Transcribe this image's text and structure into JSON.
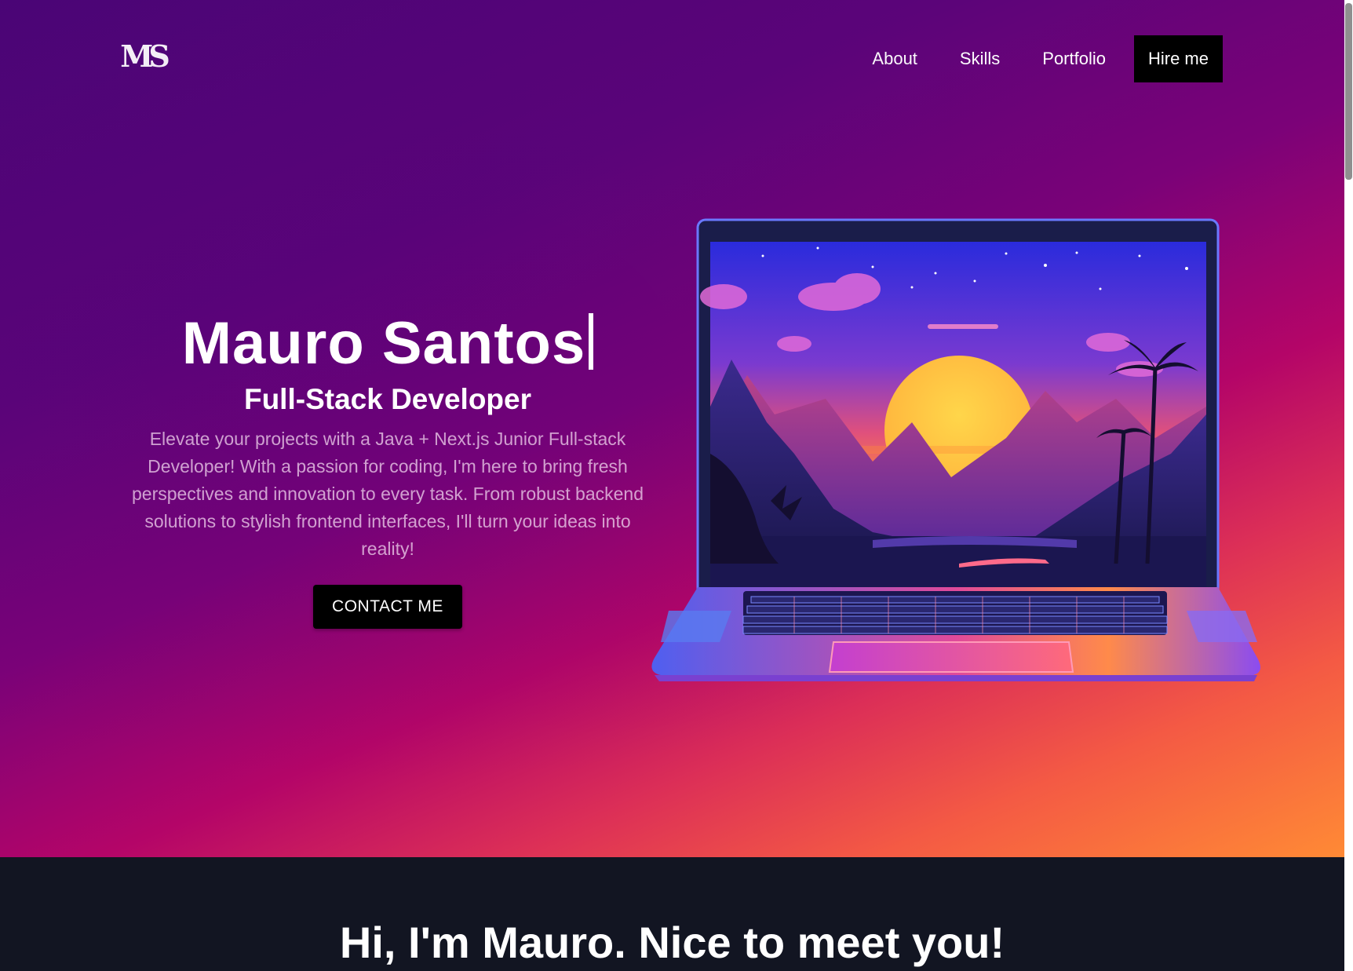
{
  "header": {
    "logo_text": "MS",
    "nav": [
      {
        "label": "About"
      },
      {
        "label": "Skills"
      },
      {
        "label": "Portfolio"
      }
    ],
    "hire_label": "Hire me"
  },
  "hero": {
    "name": "Mauro Santos",
    "role": "Full-Stack Developer",
    "description": "Elevate your projects with a Java + Next.js Junior Full-stack Developer! With a passion for coding, I'm here to bring fresh perspectives and innovation to every task. From robust backend solutions to stylish frontend interfaces, I'll turn your ideas into reality!",
    "cta_label": "CONTACT ME",
    "image_icon": "laptop-sunset-illustration"
  },
  "about": {
    "heading": "Hi, I'm Mauro. Nice to meet you!"
  },
  "colors": {
    "gradient_start": "#4a0576",
    "gradient_mid": "#b40568",
    "gradient_end": "#ff8a35",
    "dark_section": "#121522",
    "button": "#000000"
  }
}
